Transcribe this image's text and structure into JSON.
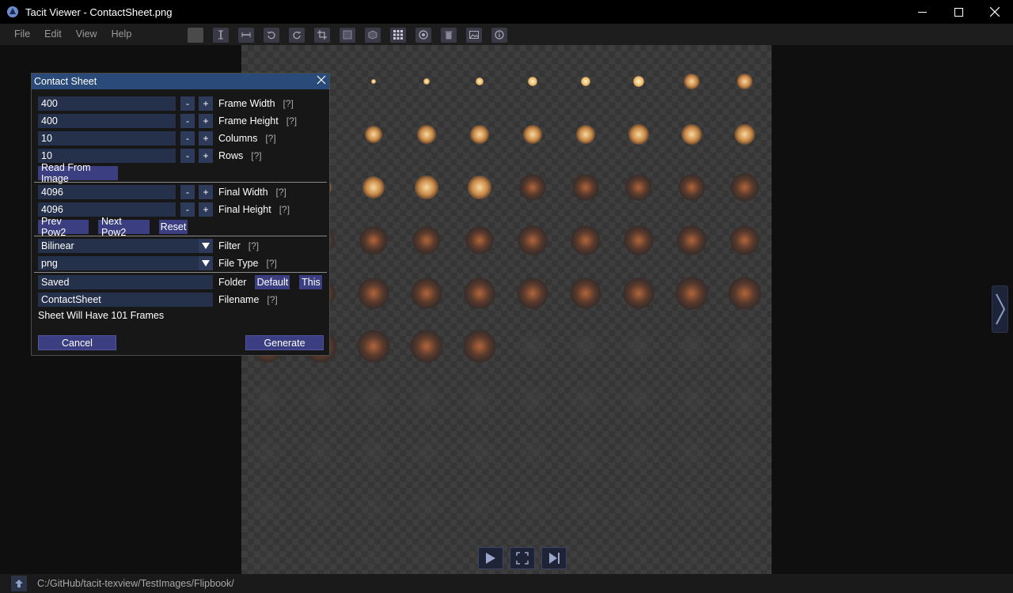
{
  "window": {
    "title": "Tacit Viewer - ContactSheet.png",
    "controls": {
      "minimize": "—",
      "maximize": "☐",
      "close": "✕"
    }
  },
  "menu": {
    "items": [
      {
        "label": "File"
      },
      {
        "label": "Edit"
      },
      {
        "label": "View"
      },
      {
        "label": "Help"
      }
    ]
  },
  "toolbar": {
    "icons": [
      "swatch-icon",
      "flip-vertical-icon",
      "flip-horizontal-icon",
      "rotate-ccw-icon",
      "rotate-cw-icon",
      "crop-icon",
      "tile-icon",
      "cube-icon",
      "contact-sheet-icon",
      "refresh-icon",
      "delete-icon",
      "image-icon",
      "info-icon"
    ]
  },
  "dialog": {
    "title": "Contact Sheet",
    "frame_width": {
      "value": "400",
      "label": "Frame Width",
      "help": "[?]"
    },
    "frame_height": {
      "value": "400",
      "label": "Frame Height",
      "help": "[?]"
    },
    "columns": {
      "value": "10",
      "label": "Columns",
      "help": "[?]"
    },
    "rows": {
      "value": "10",
      "label": "Rows",
      "help": "[?]"
    },
    "read_from_image": "Read From Image",
    "final_width": {
      "value": "4096",
      "label": "Final Width",
      "help": "[?]"
    },
    "final_height": {
      "value": "4096",
      "label": "Final Height",
      "help": "[?]"
    },
    "prev_pow2": "Prev Pow2",
    "next_pow2": "Next Pow2",
    "reset": "Reset",
    "filter": {
      "value": "Bilinear",
      "label": "Filter",
      "help": "[?]"
    },
    "file_type": {
      "value": "png",
      "label": "File Type",
      "help": "[?]"
    },
    "folder": {
      "value": "Saved",
      "label": "Folder",
      "default_btn": "Default",
      "this_btn": "This"
    },
    "filename": {
      "value": "ContactSheet",
      "label": "Filename",
      "help": "[?]"
    },
    "frame_count_text": "Sheet Will Have 101 Frames",
    "cancel": "Cancel",
    "generate": "Generate",
    "minus": "-",
    "plus": "+"
  },
  "status": {
    "path": "C:/GitHub/tacit-texview/TestImages/Flipbook/"
  },
  "colors": {
    "accent": "#3b3f82",
    "title_bar": "#2a4a7a",
    "field": "#25304a"
  }
}
